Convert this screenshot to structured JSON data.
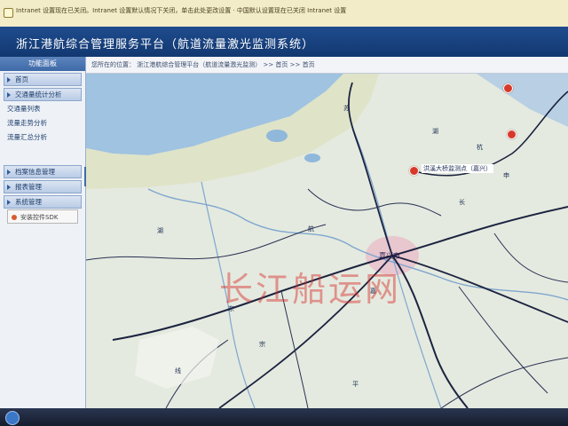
{
  "infobar": {
    "text": "Intranet 设置现在已关闭。Intranet 设置默认情况下关闭，单击此处更改设置 · 中国默认设置现在已关闭 Intranet 设置"
  },
  "header": {
    "title": "浙江港航综合管理服务平台（航道流量激光监测系统）"
  },
  "sidebar": {
    "panel_title": "功能面板",
    "home": "首页",
    "traffic_stats": "交通量统计分析",
    "items": [
      "交通量列表",
      "流量走势分析",
      "流量汇总分析"
    ],
    "sections": [
      "档案信息管理",
      "报表管理",
      "系统管理"
    ],
    "sdk_label": "安装控件SDK"
  },
  "breadcrumb": {
    "text": "您所在的位置： 浙江港航综合管理平台（航道流量激光监测） >> 首页 >> 首页"
  },
  "map": {
    "watermark": "长江船运网",
    "city_label": "嘉兴市",
    "station_label": "洪溪大桥监测点（嘉兴）",
    "labels": [
      "杭",
      "申",
      "嘉",
      "湖",
      "线",
      "苏",
      "东",
      "宗",
      "平",
      "长",
      "航",
      "湖"
    ]
  }
}
